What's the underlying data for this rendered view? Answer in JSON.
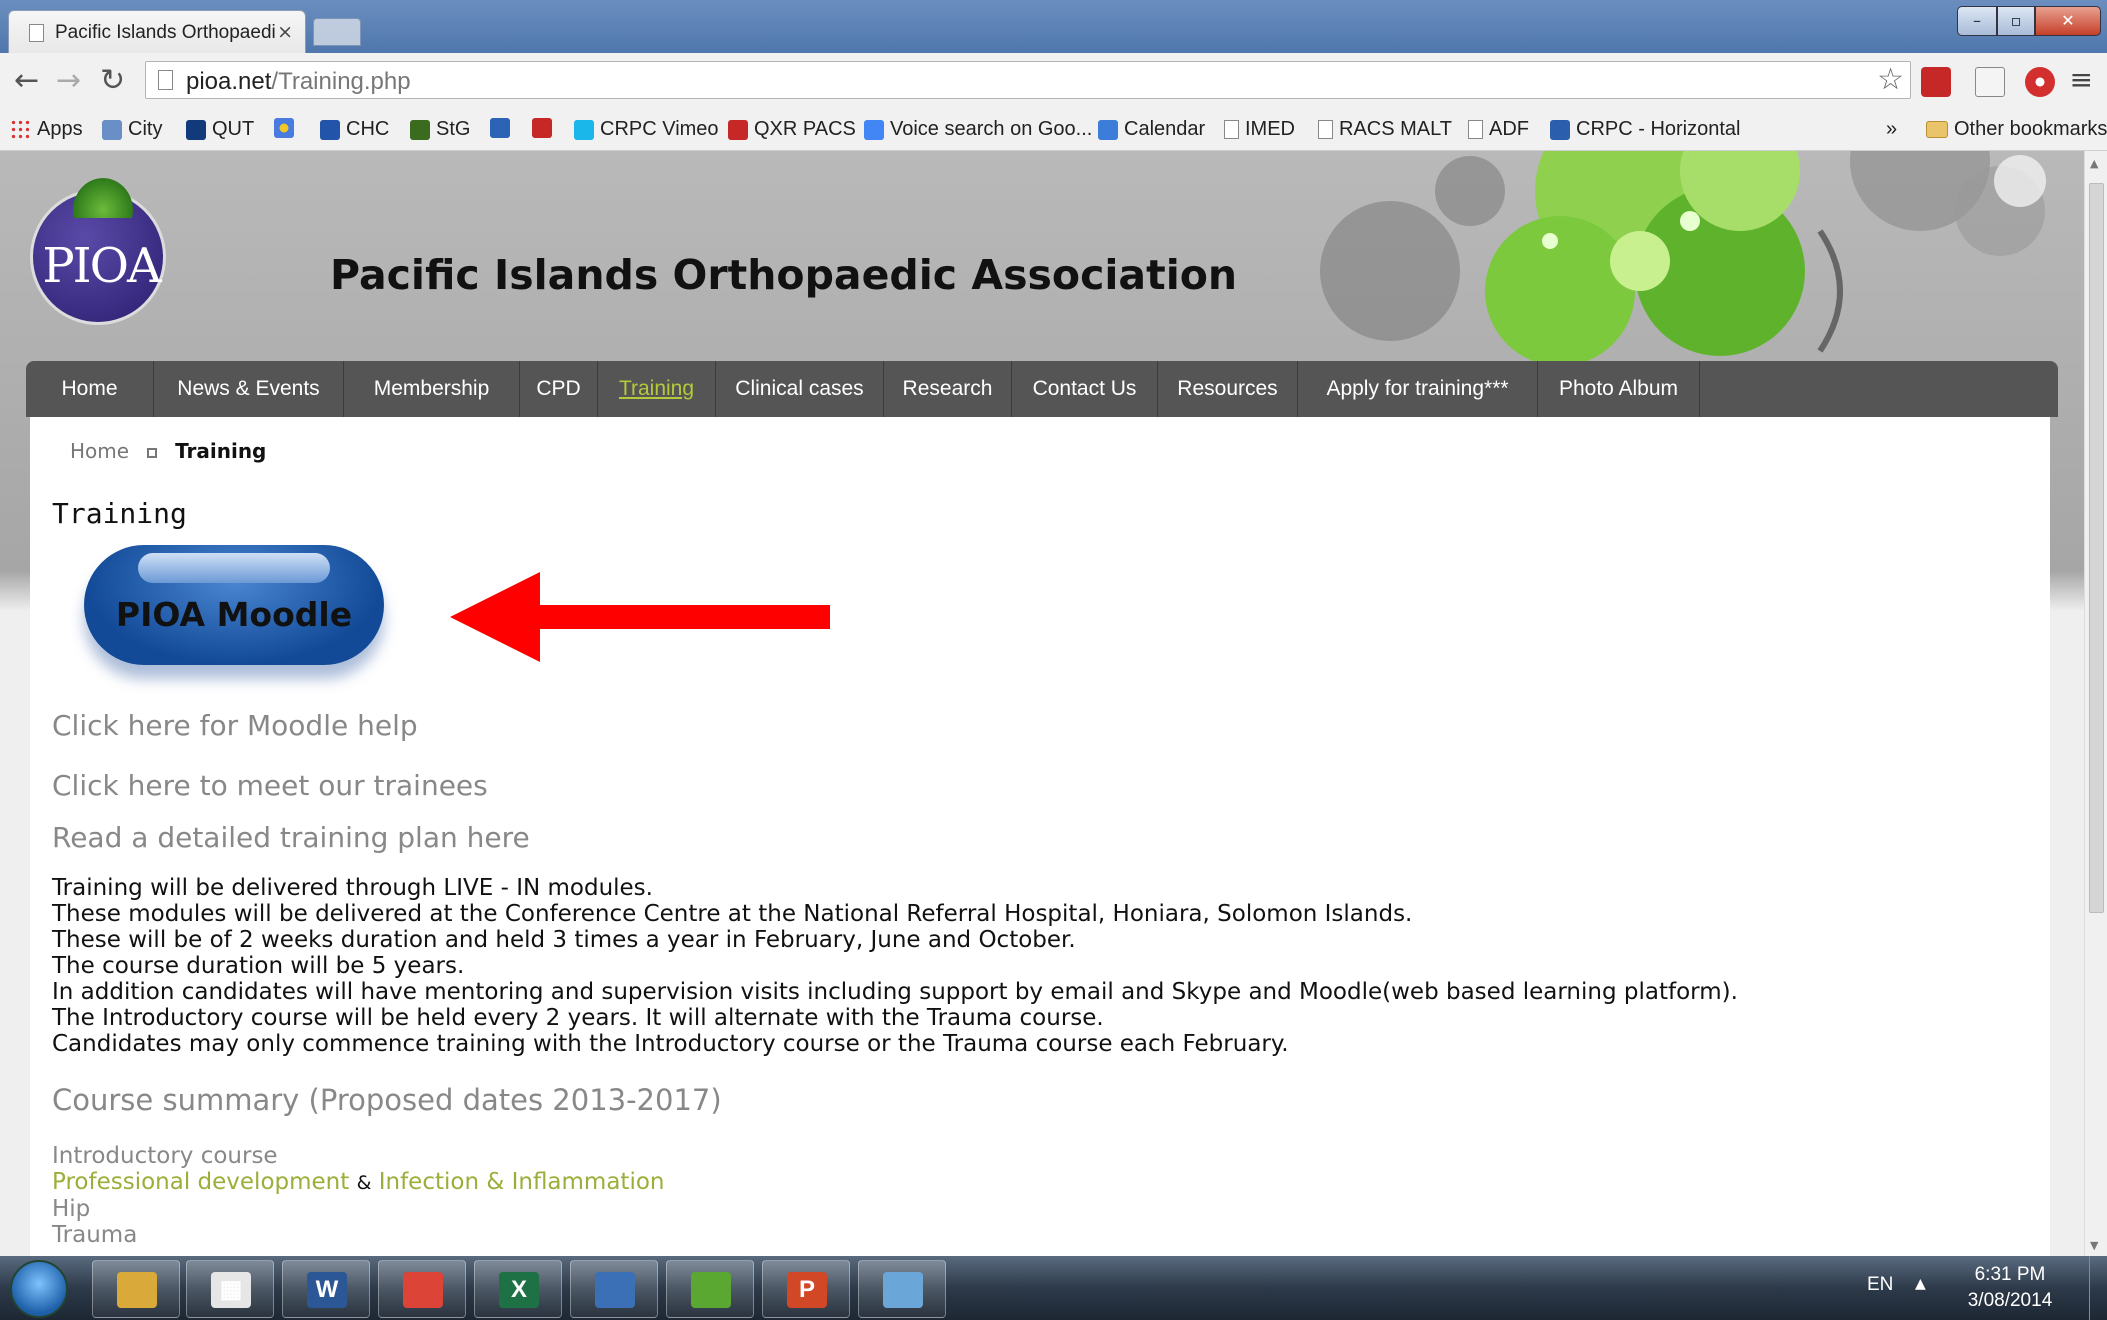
{
  "browser": {
    "tab_title": "Pacific Islands Orthopaedi",
    "tab_close": "×",
    "url_host": "pioa.net",
    "url_path": "/Training.php",
    "other_bookmarks": "Other bookmarks",
    "bookmarks_overflow": "»"
  },
  "bookmarks": [
    {
      "label": "Apps",
      "icon": "apps-grid-icon"
    },
    {
      "label": "City",
      "icon": "city-icon"
    },
    {
      "label": "QUT",
      "icon": "qut-icon"
    },
    {
      "label": "",
      "icon": "star-flower-icon"
    },
    {
      "label": "CHC",
      "icon": "chc-icon"
    },
    {
      "label": "StG",
      "icon": "stg-icon"
    },
    {
      "label": "",
      "icon": "b-icon"
    },
    {
      "label": "",
      "icon": "m-icon"
    },
    {
      "label": "CRPC Vimeo",
      "icon": "vimeo-icon"
    },
    {
      "label": "QXR PACS",
      "icon": "m-icon"
    },
    {
      "label": "Voice search on Goo...",
      "icon": "google-icon"
    },
    {
      "label": "Calendar",
      "icon": "calendar-icon"
    },
    {
      "label": "IMED",
      "icon": "page-icon"
    },
    {
      "label": "RACS MALT",
      "icon": "page-icon"
    },
    {
      "label": "ADF",
      "icon": "page-icon"
    },
    {
      "label": "CRPC - Horizontal",
      "icon": "sharepoint-icon"
    }
  ],
  "site": {
    "title": "Pacific Islands Orthopaedic Association",
    "logo_text": "PIOA"
  },
  "nav": [
    {
      "label": "Home"
    },
    {
      "label": "News & Events"
    },
    {
      "label": "Membership"
    },
    {
      "label": "CPD"
    },
    {
      "label": "Training",
      "active": true
    },
    {
      "label": "Clinical cases"
    },
    {
      "label": "Research"
    },
    {
      "label": "Contact Us"
    },
    {
      "label": "Resources"
    },
    {
      "label": "Apply for training***"
    },
    {
      "label": "Photo Album"
    }
  ],
  "breadcrumb": {
    "home": "Home",
    "current": "Training"
  },
  "content": {
    "heading": "Training",
    "moodle_button": "PIOA Moodle",
    "link_moodle_help": "Click here for Moodle help",
    "link_trainees": "Click here to meet our trainees",
    "link_plan": "Read a detailed training plan here",
    "paragraph_lines": [
      "Training will be delivered through LIVE - IN modules.",
      "These modules will be delivered at the Conference Centre at the National Referral Hospital, Honiara, Solomon Islands.",
      "These will be of 2 weeks duration and held 3 times a year in February, June and October.",
      "The course duration will be 5 years.",
      "In addition candidates will have mentoring and supervision visits including support by email and Skype and Moodle(web based learning platform).",
      "The Introductory course will be held every 2 years. It will alternate with the Trauma course.",
      "Candidates may only commence training with the Introductory course or the Trauma course each February."
    ],
    "summary_heading": "Course summary (Proposed dates 2013-2017)",
    "course_intro": "Introductory course",
    "course_prof_dev": "Professional development",
    "course_amp": "&",
    "course_infection": "Infection & Inflammation",
    "course_hip": "Hip",
    "course_trauma": "Trauma"
  },
  "taskbar": {
    "apps": [
      {
        "name": "file-explorer",
        "glyph": "",
        "color": "#d9a93a"
      },
      {
        "name": "apps",
        "glyph": "▦",
        "color": "#e6e6e6"
      },
      {
        "name": "word",
        "glyph": "W",
        "color": "#2b5797"
      },
      {
        "name": "chrome",
        "glyph": "",
        "color": "#db4437"
      },
      {
        "name": "excel",
        "glyph": "X",
        "color": "#1e7145"
      },
      {
        "name": "thunderbird",
        "glyph": "",
        "color": "#3b6fb6"
      },
      {
        "name": "evernote",
        "glyph": "",
        "color": "#5aa832"
      },
      {
        "name": "powerpoint",
        "glyph": "P",
        "color": "#d24726"
      },
      {
        "name": "paint",
        "glyph": "",
        "color": "#6aa6d8"
      }
    ],
    "lang": "EN",
    "tray_up": "▲",
    "time": "6:31 PM",
    "date": "3/08/2014"
  },
  "colors": {
    "nav_bg": "#555555",
    "nav_active": "#b5c93a",
    "link_grey": "#888888",
    "link_green": "#9cae3a",
    "arrow_red": "#ff0000",
    "moodle_blue": "#124a98"
  }
}
